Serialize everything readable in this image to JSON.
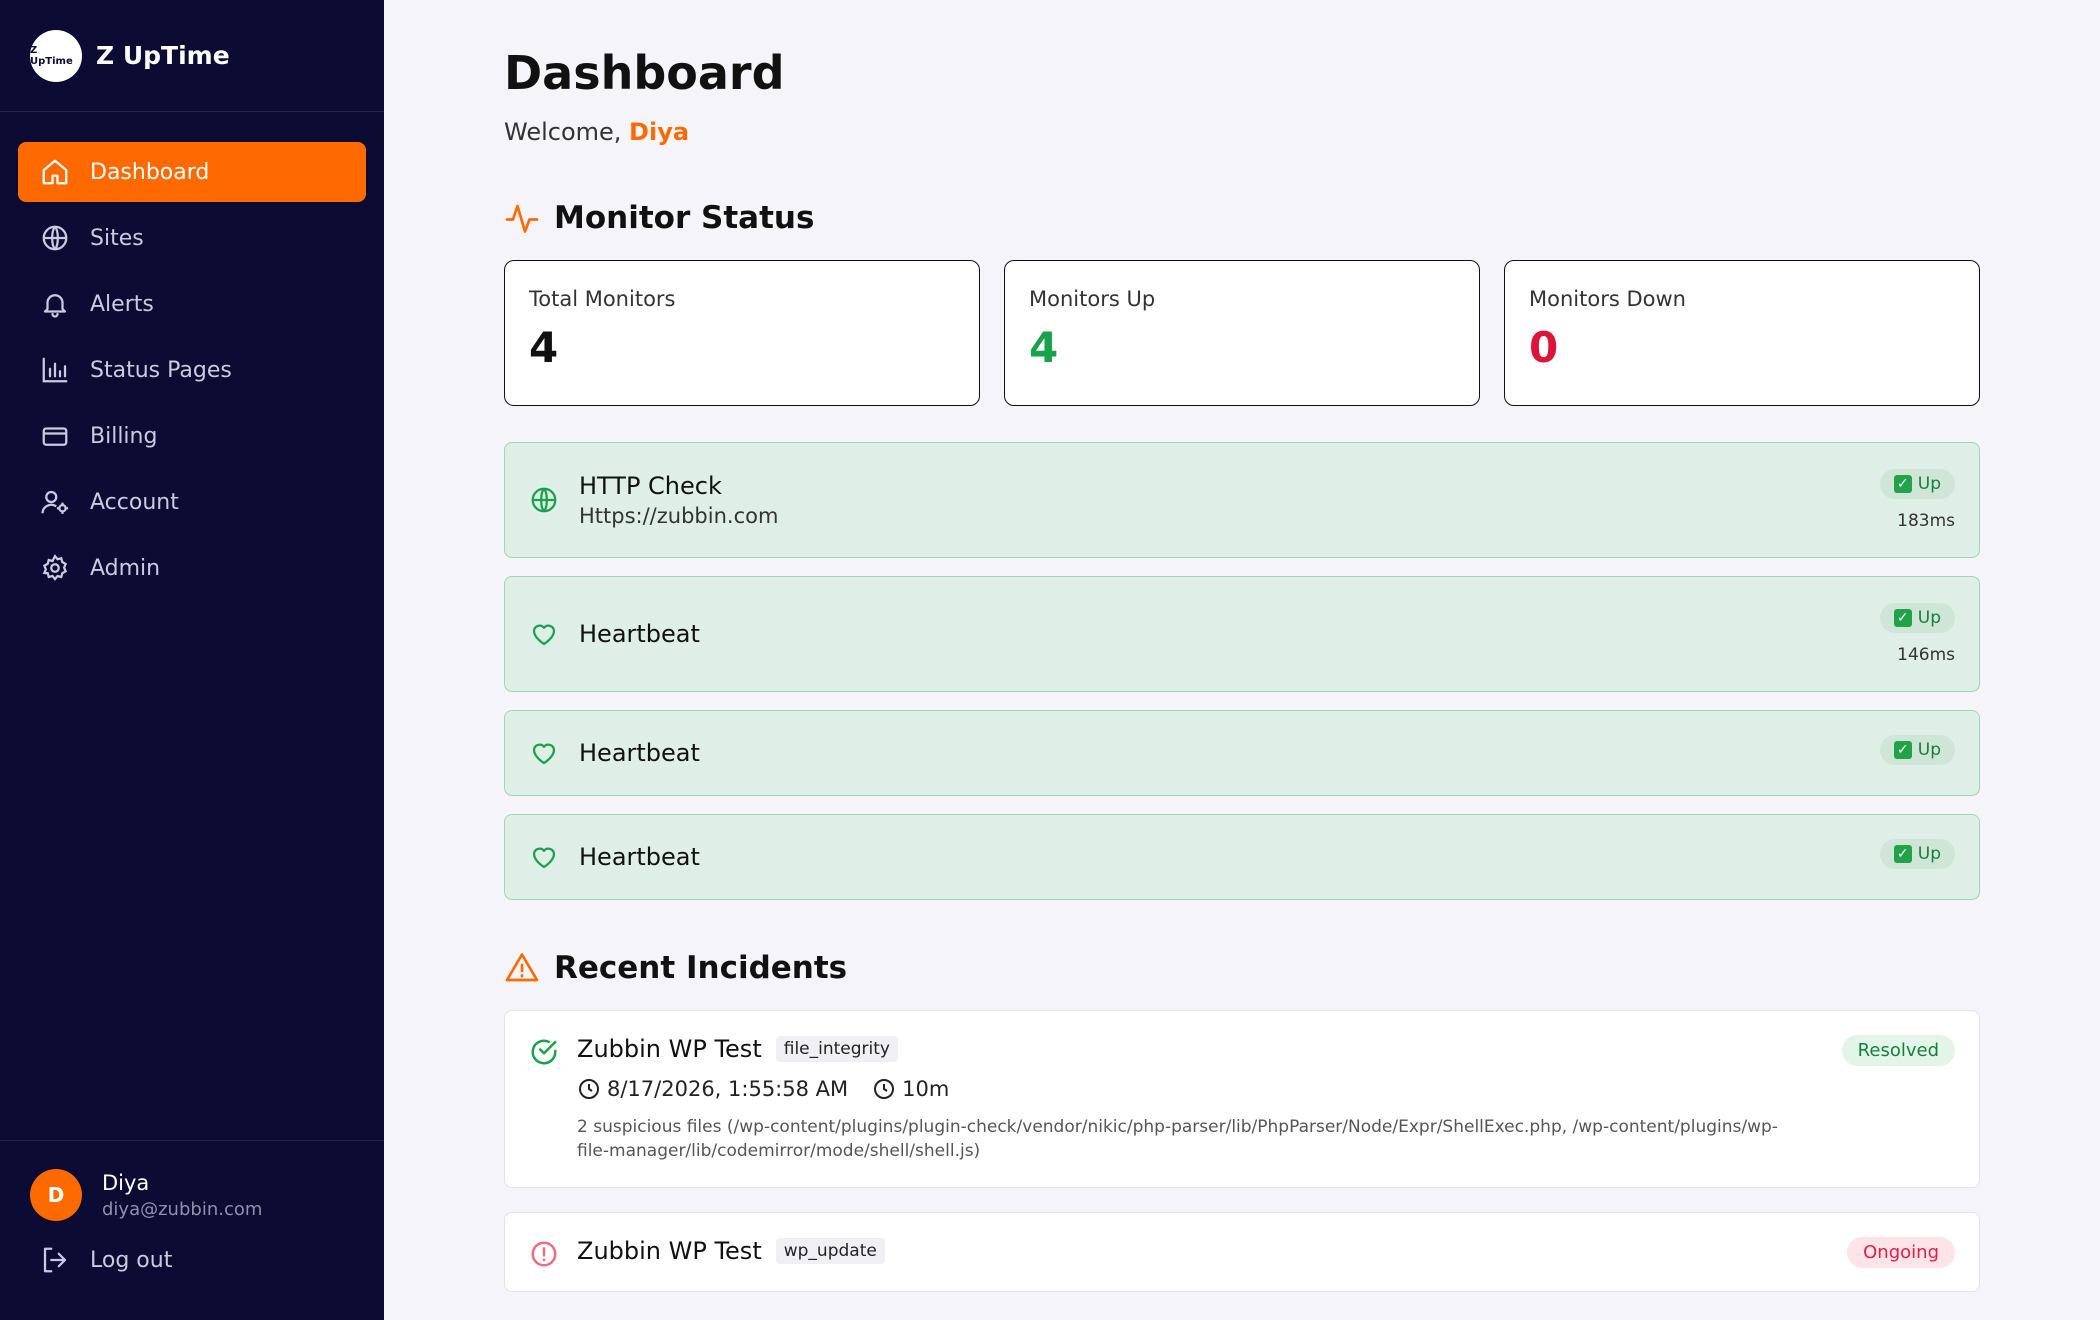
{
  "app": {
    "name": "Z UpTime",
    "logo_text": "Z UpTime"
  },
  "nav": [
    {
      "label": "Dashboard",
      "icon": "home-icon",
      "active": true
    },
    {
      "label": "Sites",
      "icon": "globe-icon"
    },
    {
      "label": "Alerts",
      "icon": "bell-icon"
    },
    {
      "label": "Status Pages",
      "icon": "bar-chart-icon"
    },
    {
      "label": "Billing",
      "icon": "credit-card-icon"
    },
    {
      "label": "Account",
      "icon": "user-gear-icon"
    },
    {
      "label": "Admin",
      "icon": "gear-icon"
    }
  ],
  "user": {
    "initial": "D",
    "name": "Diya",
    "email": "diya@zubbin.com",
    "logout_label": "Log out"
  },
  "page": {
    "title": "Dashboard",
    "welcome_prefix": "Welcome, ",
    "welcome_name": "Diya"
  },
  "monitor_status": {
    "title": "Monitor Status",
    "stats": [
      {
        "label": "Total Monitors",
        "value": "4"
      },
      {
        "label": "Monitors Up",
        "value": "4"
      },
      {
        "label": "Monitors Down",
        "value": "0"
      }
    ]
  },
  "monitors": [
    {
      "name": "HTTP Check",
      "url": "Https://zubbin.com",
      "status": "Up",
      "latency": "183ms",
      "icon": "globe-icon"
    },
    {
      "name": "Heartbeat",
      "status": "Up",
      "latency": "146ms",
      "icon": "heart-icon"
    },
    {
      "name": "Heartbeat",
      "status": "Up",
      "icon": "heart-icon"
    },
    {
      "name": "Heartbeat",
      "status": "Up",
      "icon": "heart-icon"
    }
  ],
  "incidents": {
    "title": "Recent Incidents",
    "items": [
      {
        "name": "Zubbin WP Test",
        "tag": "file_integrity",
        "status": "Resolved",
        "time": "8/17/2026, 1:55:58 AM",
        "duration": "10m",
        "description": "2 suspicious files (/wp-content/plugins/plugin-check/vendor/nikic/php-parser/lib/PhpParser/Node/Expr/ShellExec.php, /wp-content/plugins/wp-file-manager/lib/codemirror/mode/shell/shell.js)"
      },
      {
        "name": "Zubbin WP Test",
        "tag": "wp_update",
        "status": "Ongoing"
      }
    ]
  },
  "colors": {
    "accent": "#ff6a00",
    "sidebar": "#0b0b33",
    "up": "#16a34a",
    "down": "#dc143c"
  }
}
